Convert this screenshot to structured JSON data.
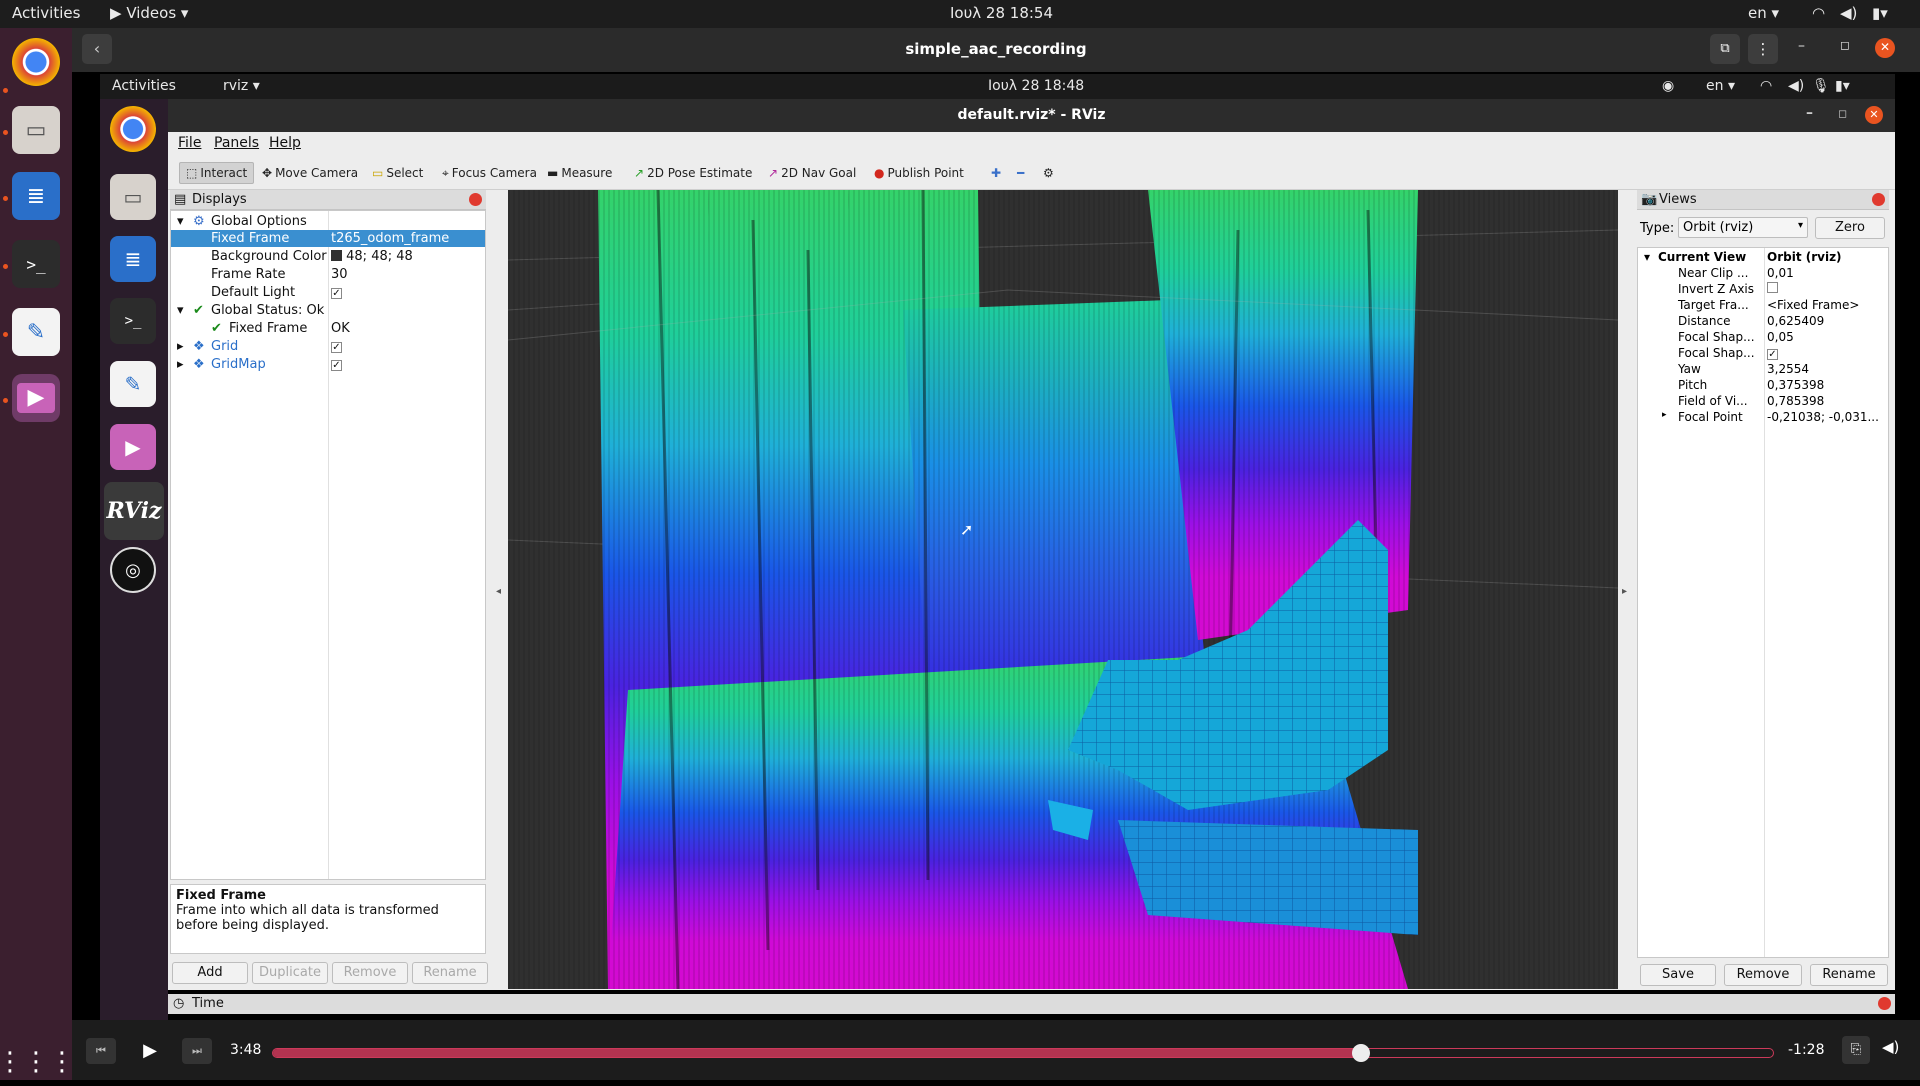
{
  "outer_topbar": {
    "activities": "Activities",
    "app_menu": "Videos",
    "clock": "Ιουλ 28  18:54",
    "lang": "en"
  },
  "player": {
    "title": "simple_aac_recording",
    "elapsed": "3:48",
    "remaining": "-1:28",
    "progress": 0.725
  },
  "inner_topbar": {
    "activities": "Activities",
    "app_menu": "rviz",
    "clock": "Ιουλ 28  18:48",
    "lang": "en"
  },
  "rviz": {
    "title": "default.rviz* - RViz",
    "menu": [
      "File",
      "Panels",
      "Help"
    ],
    "toolbar": [
      "Interact",
      "Move Camera",
      "Select",
      "Focus Camera",
      "Measure",
      "2D Pose Estimate",
      "2D Nav Goal",
      "Publish Point"
    ],
    "displays": {
      "title": "Displays",
      "rows": [
        {
          "label": "Global Options",
          "value": ""
        },
        {
          "label": "Fixed Frame",
          "value": "t265_odom_frame"
        },
        {
          "label": "Background Color",
          "value": "48; 48; 48"
        },
        {
          "label": "Frame Rate",
          "value": "30"
        },
        {
          "label": "Default Light",
          "value": ""
        },
        {
          "label": "Global Status: Ok",
          "value": ""
        },
        {
          "label": "Fixed Frame",
          "value": "OK"
        },
        {
          "label": "Grid",
          "value": ""
        },
        {
          "label": "GridMap",
          "value": ""
        }
      ],
      "desc_title": "Fixed Frame",
      "desc_body": "Frame into which all data is transformed before being displayed.",
      "buttons": [
        "Add",
        "Duplicate",
        "Remove",
        "Rename"
      ]
    },
    "views": {
      "title": "Views",
      "type_label": "Type:",
      "type_value": "Orbit (rviz)",
      "zero": "Zero",
      "current_view": "Current View",
      "current_view_type": "Orbit (rviz)",
      "props": [
        {
          "label": "Near Clip ...",
          "value": "0,01"
        },
        {
          "label": "Invert Z Axis",
          "value": ""
        },
        {
          "label": "Target Fra...",
          "value": "<Fixed Frame>"
        },
        {
          "label": "Distance",
          "value": "0,625409"
        },
        {
          "label": "Focal Shap...",
          "value": "0,05"
        },
        {
          "label": "Focal Shap...",
          "value": ""
        },
        {
          "label": "Yaw",
          "value": "3,2554"
        },
        {
          "label": "Pitch",
          "value": "0,375398"
        },
        {
          "label": "Field of Vi...",
          "value": "0,785398"
        },
        {
          "label": "Focal Point",
          "value": "-0,21038; -0,031..."
        }
      ],
      "buttons": [
        "Save",
        "Remove",
        "Rename"
      ]
    },
    "time_label": "Time",
    "inner_dock_rviz": "RViz"
  }
}
